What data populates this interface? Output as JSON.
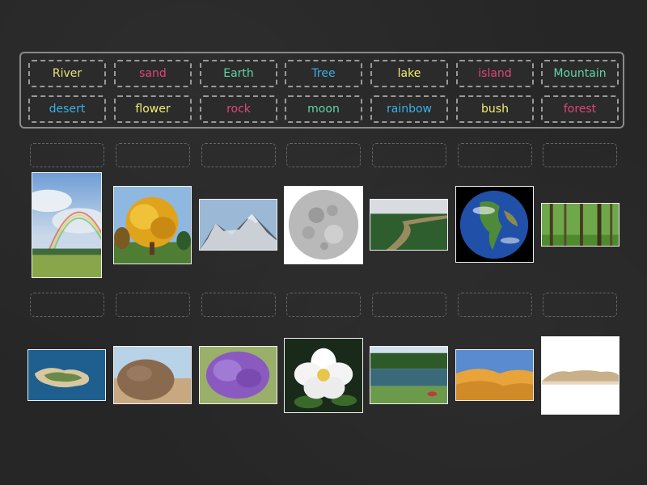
{
  "word_bank": [
    {
      "label": "River",
      "color": "#e6e27a"
    },
    {
      "label": "sand",
      "color": "#e0457b"
    },
    {
      "label": "Earth",
      "color": "#5fd6a8"
    },
    {
      "label": "Tree",
      "color": "#3ab0e8"
    },
    {
      "label": "lake",
      "color": "#f2ee74"
    },
    {
      "label": "island",
      "color": "#e0457b"
    },
    {
      "label": "Mountain",
      "color": "#5fd6a8"
    },
    {
      "label": "desert",
      "color": "#3ab0e8"
    },
    {
      "label": "flower",
      "color": "#f2ee74"
    },
    {
      "label": "rock",
      "color": "#e0457b"
    },
    {
      "label": "moon",
      "color": "#5fd6a8"
    },
    {
      "label": "rainbow",
      "color": "#3ab0e8"
    },
    {
      "label": "bush",
      "color": "#f2ee74"
    },
    {
      "label": "forest",
      "color": "#e0457b"
    }
  ],
  "images_row1": [
    "rainbow-image",
    "tree-image",
    "mountain-image",
    "moon-image",
    "river-image",
    "earth-image",
    "forest-image"
  ],
  "images_row2": [
    "island-image",
    "rock-image",
    "bush-image",
    "flower-image",
    "lake-image",
    "desert-image",
    "sand-image"
  ]
}
